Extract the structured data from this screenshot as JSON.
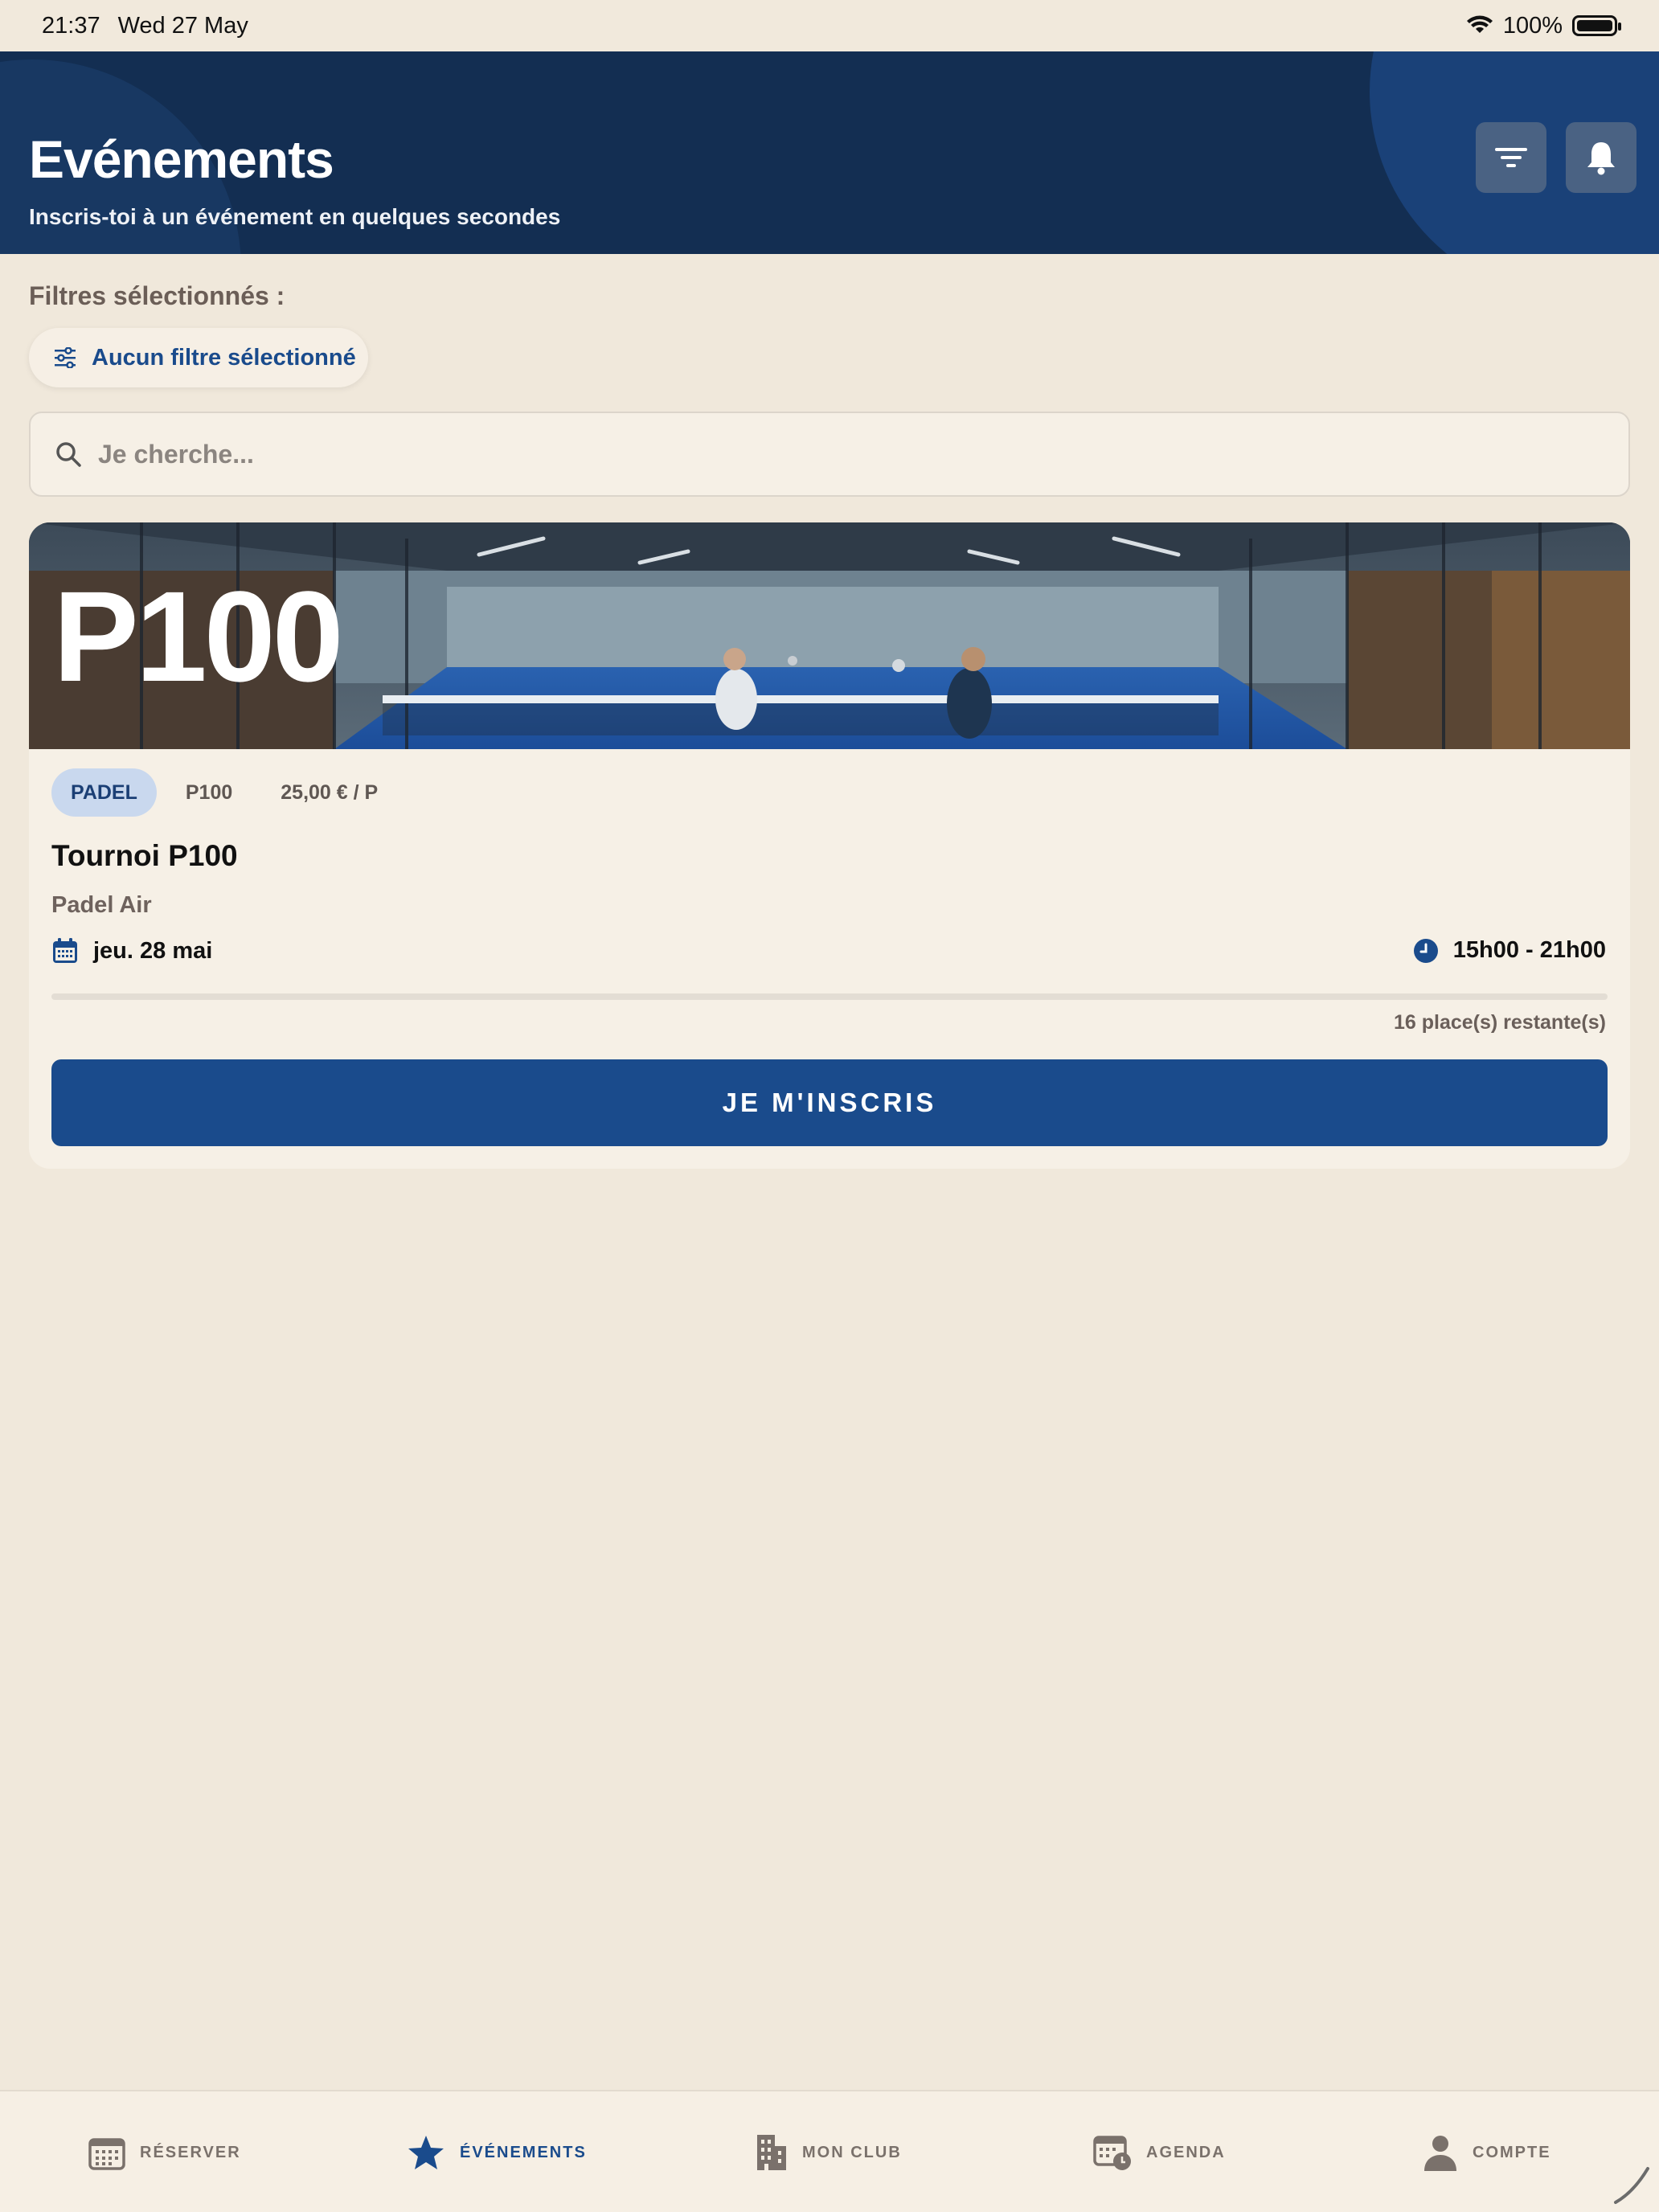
{
  "status_bar": {
    "time": "21:37",
    "date": "Wed 27 May",
    "battery": "100%"
  },
  "header": {
    "title": "Evénements",
    "subtitle": "Inscris-toi à un événement en quelques secondes",
    "filter_icon": "filter-icon",
    "bell_icon": "bell-icon"
  },
  "filters": {
    "label": "Filtres sélectionnés :",
    "chip_label": "Aucun filtre sélectionné"
  },
  "search": {
    "placeholder": "Je cherche..."
  },
  "event": {
    "banner_text": "P100",
    "tags": [
      "PADEL",
      "P100",
      "25,00 € / P"
    ],
    "title": "Tournoi P100",
    "venue": "Padel Air",
    "date": "jeu. 28 mai",
    "time": "15h00 - 21h00",
    "fill_fraction": 0,
    "remaining": "16 place(s) restante(s)",
    "cta": "JE M'INSCRIS"
  },
  "tabbar": {
    "items": [
      {
        "label": "RÉSERVER",
        "icon": "calendar-grid-icon",
        "active": false
      },
      {
        "label": "ÉVÉNEMENTS",
        "icon": "star-icon",
        "active": true
      },
      {
        "label": "MON CLUB",
        "icon": "building-icon",
        "active": false
      },
      {
        "label": "AGENDA",
        "icon": "calendar-clock-icon",
        "active": false
      },
      {
        "label": "COMPTE",
        "icon": "person-icon",
        "active": false
      }
    ]
  },
  "colors": {
    "navy": "#132e52",
    "accent": "#1a4b8c",
    "background": "#f0e8db",
    "card": "#f6f0e6"
  }
}
